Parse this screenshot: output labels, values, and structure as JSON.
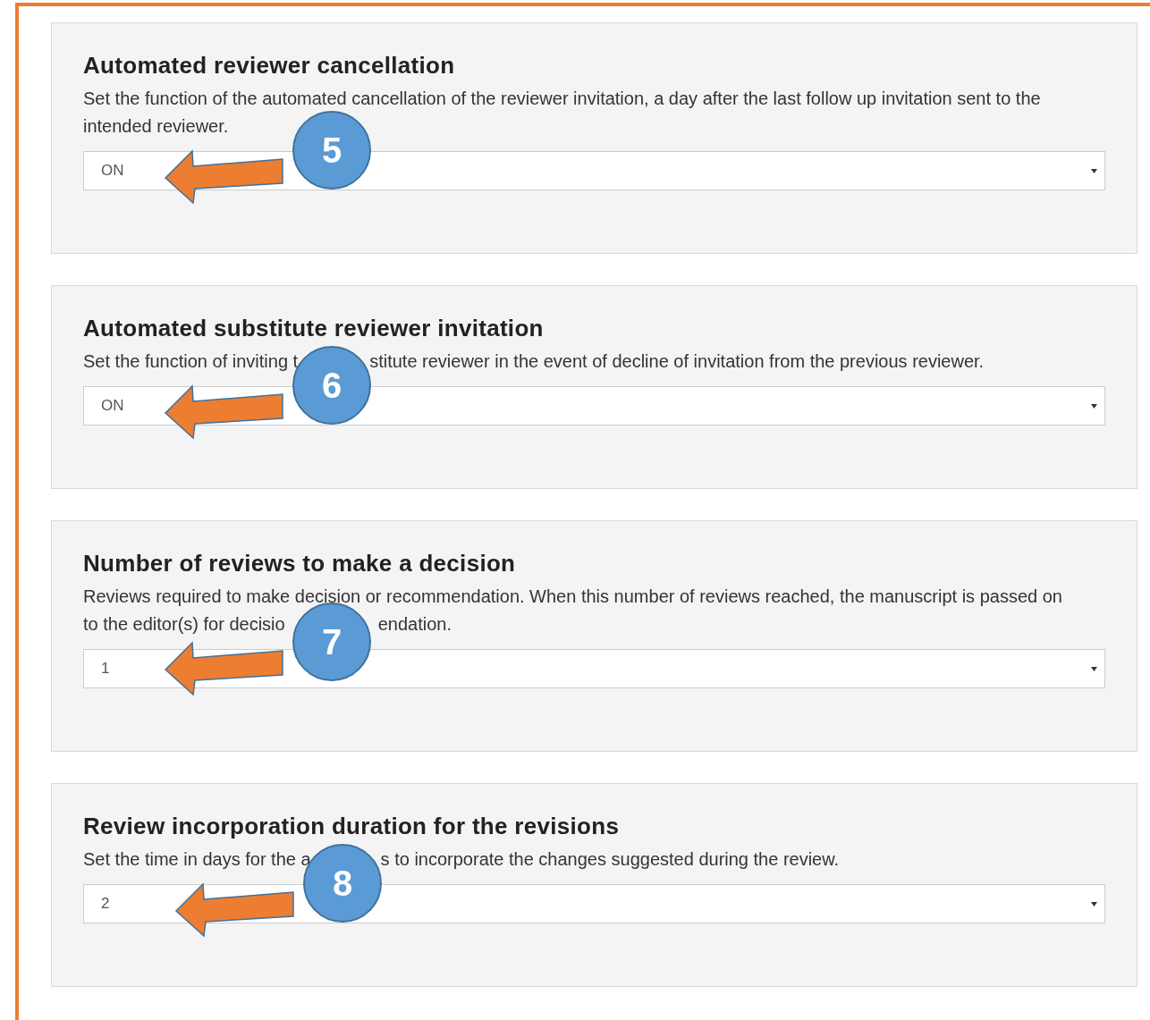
{
  "sections": [
    {
      "title": "Automated reviewer cancellation",
      "description": [
        [
          "Set the function of the automated cancellation of the reviewer invitation, a day after the last follow up invitation sent to the intended reviewer."
        ]
      ],
      "value": "ON",
      "marker": "5"
    },
    {
      "title": "Automated substitute reviewer invitation",
      "description": [
        [
          "Set the function of inviting t",
          "stitute reviewer in the event of decline of invitation from the previous reviewer."
        ]
      ],
      "value": "ON",
      "marker": "6"
    },
    {
      "title": "Number of reviews to make a decision",
      "description": [
        [
          "Reviews required to make decision or recommendation. When this number of reviews reached, the manuscript is passed on"
        ],
        [
          "to the editor(s) for decisio",
          "endation."
        ]
      ],
      "value": "1",
      "marker": "7"
    },
    {
      "title": "Review incorporation duration for the revisions",
      "description": [
        [
          "Set the time in days for the a",
          "s to incorporate the changes suggested during the review."
        ]
      ],
      "value": "2",
      "marker": "8"
    }
  ]
}
